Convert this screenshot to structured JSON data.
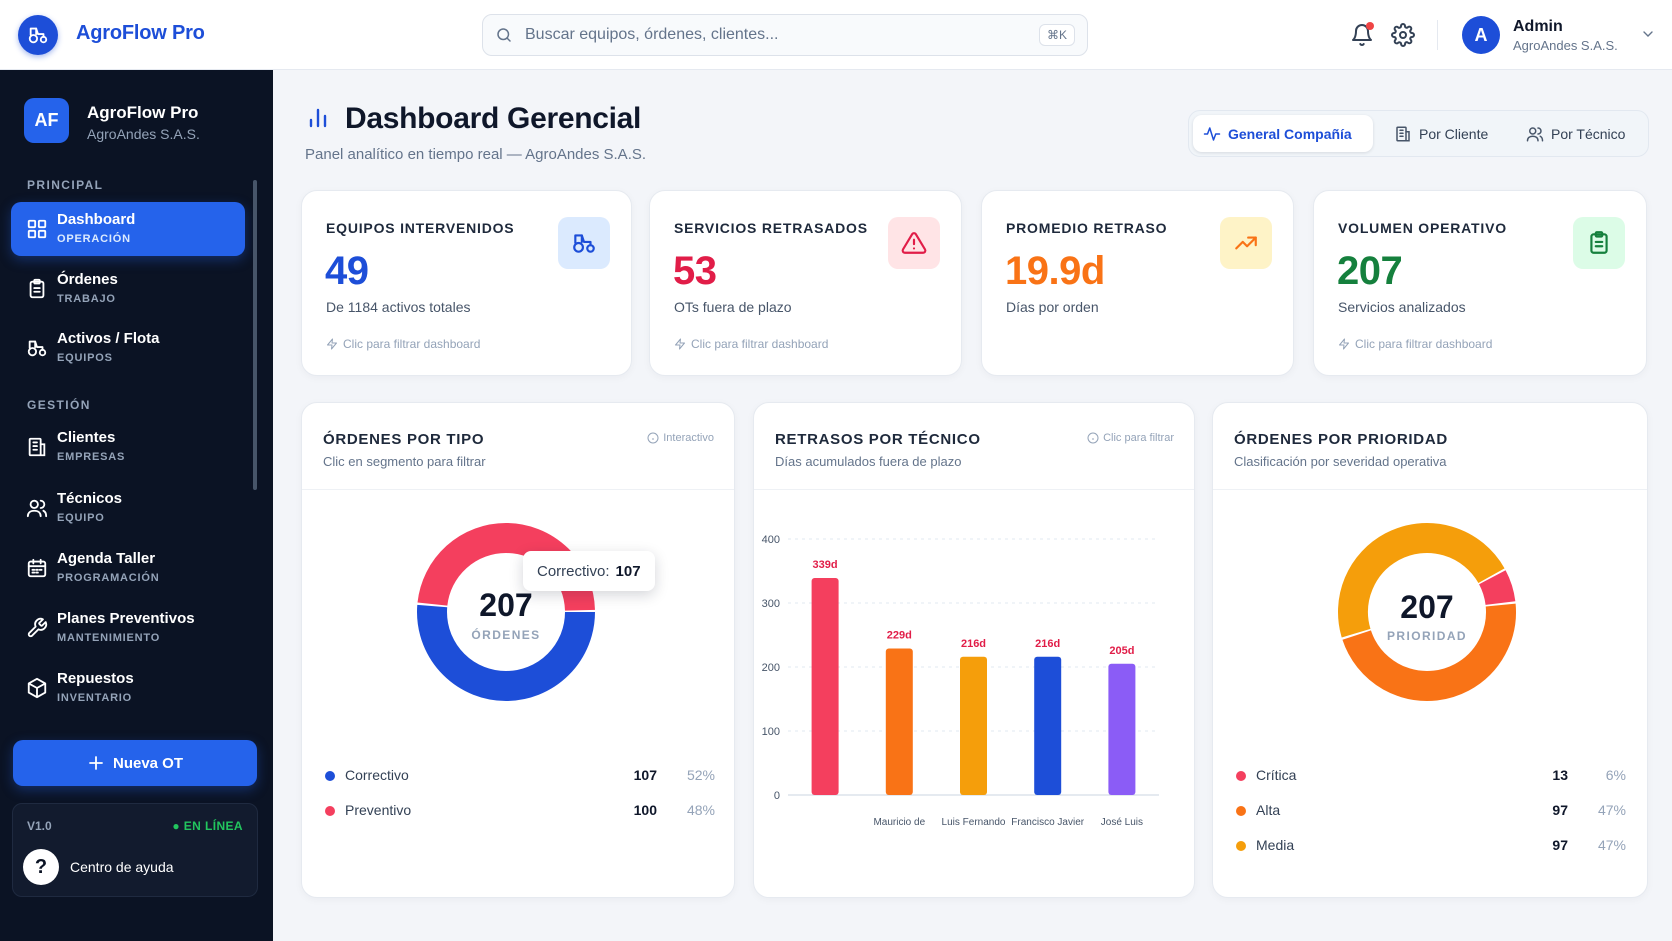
{
  "brand": {
    "name": "AgroFlow Pro"
  },
  "search": {
    "placeholder": "Buscar equipos, órdenes, clientes...",
    "shortcut": "⌘K"
  },
  "user": {
    "initial": "A",
    "name": "Admin",
    "org": "AgroAndes S.A.S."
  },
  "sidebar": {
    "logo_initials": "AF",
    "app_name": "AgroFlow Pro",
    "org": "AgroAndes S.A.S.",
    "sections": [
      "PRINCIPAL",
      "GESTIÓN"
    ],
    "items": [
      {
        "label": "Dashboard",
        "sub": "OPERACIÓN",
        "icon": "grid-icon"
      },
      {
        "label": "Órdenes",
        "sub": "TRABAJO",
        "icon": "clipboard-icon"
      },
      {
        "label": "Activos / Flota",
        "sub": "EQUIPOS",
        "icon": "tractor-icon"
      },
      {
        "label": "Clientes",
        "sub": "EMPRESAS",
        "icon": "building-icon"
      },
      {
        "label": "Técnicos",
        "sub": "EQUIPO",
        "icon": "users-icon"
      },
      {
        "label": "Agenda Taller",
        "sub": "PROGRAMACIÓN",
        "icon": "calendar-icon"
      },
      {
        "label": "Planes Preventivos",
        "sub": "MANTENIMIENTO",
        "icon": "wrench-icon"
      },
      {
        "label": "Repuestos",
        "sub": "INVENTARIO",
        "icon": "box-icon"
      }
    ],
    "new_button": "Nueva OT",
    "version": "V1.0",
    "status": "EN LÍNEA",
    "help": "Centro de ayuda"
  },
  "header": {
    "title": "Dashboard Gerencial",
    "subtitle": "Panel analítico en tiempo real — AgroAndes S.A.S.",
    "tabs": [
      {
        "label": "General Compañía",
        "icon": "activity-icon"
      },
      {
        "label": "Por Cliente",
        "icon": "building-icon"
      },
      {
        "label": "Por Técnico",
        "icon": "users-icon"
      }
    ]
  },
  "kpis": [
    {
      "title": "EQUIPOS INTERVENIDOS",
      "value": "49",
      "desc": "De 1184 activos totales",
      "link": "Clic para filtrar dashboard",
      "color": "#1d4ed8",
      "icon": "tractor-icon"
    },
    {
      "title": "SERVICIOS RETRASADOS",
      "value": "53",
      "desc": "OTs fuera de plazo",
      "link": "Clic para filtrar dashboard",
      "color": "#e11d48",
      "icon": "alert-triangle-icon"
    },
    {
      "title": "PROMEDIO RETRASO",
      "value": "19.9d",
      "desc": "Días por orden",
      "link": "",
      "color": "#f97316",
      "icon": "trending-up-icon"
    },
    {
      "title": "VOLUMEN OPERATIVO",
      "value": "207",
      "desc": "Servicios analizados",
      "link": "Clic para filtrar dashboard",
      "color": "#15803d",
      "icon": "clipboard-check-icon"
    }
  ],
  "charts": {
    "tipo": {
      "title": "ÓRDENES POR TIPO",
      "subtitle": "Clic en segmento para filtrar",
      "hint": "Interactivo",
      "center_value": "207",
      "center_label": "ÓRDENES",
      "tooltip_label": "Correctivo:",
      "tooltip_value": "107",
      "legend": [
        {
          "name": "Correctivo",
          "count": "107",
          "pct": "52%",
          "color": "#1d4ed8"
        },
        {
          "name": "Preventivo",
          "count": "100",
          "pct": "48%",
          "color": "#f43f5e"
        }
      ]
    },
    "retrasos": {
      "title": "RETRASOS POR TÉCNICO",
      "subtitle": "Días acumulados fuera de plazo",
      "hint": "Clic para filtrar"
    },
    "prioridad": {
      "title": "ÓRDENES POR PRIORIDAD",
      "subtitle": "Clasificación por severidad operativa",
      "center_value": "207",
      "center_label": "PRIORIDAD",
      "legend": [
        {
          "name": "Crítica",
          "count": "13",
          "pct": "6%",
          "color": "#f43f5e"
        },
        {
          "name": "Alta",
          "count": "97",
          "pct": "47%",
          "color": "#f97316"
        },
        {
          "name": "Media",
          "count": "97",
          "pct": "47%",
          "color": "#f59e0b"
        }
      ]
    }
  },
  "chart_data": [
    {
      "type": "pie",
      "title": "ÓRDENES POR TIPO",
      "categories": [
        "Correctivo",
        "Preventivo"
      ],
      "values": [
        107,
        100
      ],
      "colors": [
        "#1d4ed8",
        "#f43f5e"
      ]
    },
    {
      "type": "bar",
      "title": "RETRASOS POR TÉCNICO",
      "categories": [
        "",
        "Mauricio de",
        "Luis Fernando",
        "Francisco Javier",
        "José Luis"
      ],
      "values": [
        339,
        229,
        216,
        216,
        205
      ],
      "data_labels": [
        "339d",
        "229d",
        "216d",
        "216d",
        "205d"
      ],
      "colors": [
        "#f43f5e",
        "#f97316",
        "#f59e0b",
        "#1d4ed8",
        "#8b5cf6"
      ],
      "ylim": [
        0,
        400
      ],
      "yticks": [
        0,
        100,
        200,
        300,
        400
      ],
      "grid": true
    },
    {
      "type": "pie",
      "title": "ÓRDENES POR PRIORIDAD",
      "categories": [
        "Crítica",
        "Alta",
        "Media"
      ],
      "values": [
        13,
        97,
        97
      ],
      "colors": [
        "#f43f5e",
        "#f97316",
        "#f59e0b"
      ]
    }
  ]
}
